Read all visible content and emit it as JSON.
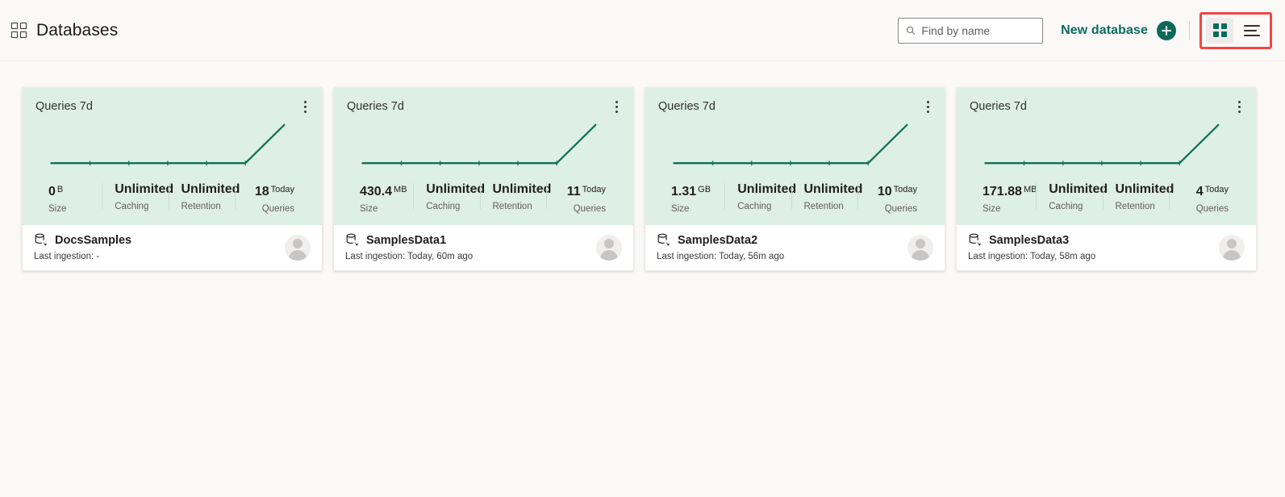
{
  "header": {
    "icon": "grid-icon",
    "title": "Databases",
    "search": {
      "value": "",
      "placeholder": "Find by name",
      "icon": "search-icon"
    },
    "new_database": {
      "label": "New database",
      "icon": "plus-circle-icon"
    },
    "view_toggle": {
      "grid": {
        "icon": "grid-view-icon",
        "active": true
      },
      "list": {
        "icon": "list-view-icon",
        "active": false
      },
      "highlight_color": "#f4463f"
    }
  },
  "colors": {
    "accent": "#0b6a5a",
    "card_top_bg": "#deefe5",
    "spark_line": "#107159",
    "page_bg": "#faf9f8"
  },
  "chart_data": {
    "type": "line",
    "title": "Queries 7d",
    "x": [
      0,
      1,
      2,
      3,
      4,
      5,
      6
    ],
    "values": [
      0,
      0,
      0,
      0,
      0,
      0,
      1
    ],
    "grid": false,
    "legend": "none",
    "xlabel": "",
    "ylabel": ""
  },
  "cards": [
    {
      "chart_title": "Queries 7d",
      "menu_icon": "kebab-menu-icon",
      "stats": [
        {
          "value": "0",
          "unit": "B",
          "label": "Size"
        },
        {
          "value": "Unlimited",
          "unit": "",
          "label": "Caching"
        },
        {
          "value": "Unlimited",
          "unit": "",
          "label": "Retention"
        },
        {
          "value": "18",
          "unit": "Today",
          "label": "Queries"
        }
      ],
      "db_icon": "database-icon",
      "name": "DocsSamples",
      "last_ingestion": "Last ingestion: -",
      "avatar": "user-avatar"
    },
    {
      "chart_title": "Queries 7d",
      "menu_icon": "kebab-menu-icon",
      "stats": [
        {
          "value": "430.4",
          "unit": "MB",
          "label": "Size"
        },
        {
          "value": "Unlimited",
          "unit": "",
          "label": "Caching"
        },
        {
          "value": "Unlimited",
          "unit": "",
          "label": "Retention"
        },
        {
          "value": "11",
          "unit": "Today",
          "label": "Queries"
        }
      ],
      "db_icon": "database-icon",
      "name": "SamplesData1",
      "last_ingestion": "Last ingestion: Today, 60m ago",
      "avatar": "user-avatar"
    },
    {
      "chart_title": "Queries 7d",
      "menu_icon": "kebab-menu-icon",
      "stats": [
        {
          "value": "1.31",
          "unit": "GB",
          "label": "Size"
        },
        {
          "value": "Unlimited",
          "unit": "",
          "label": "Caching"
        },
        {
          "value": "Unlimited",
          "unit": "",
          "label": "Retention"
        },
        {
          "value": "10",
          "unit": "Today",
          "label": "Queries"
        }
      ],
      "db_icon": "database-icon",
      "name": "SamplesData2",
      "last_ingestion": "Last ingestion: Today, 56m ago",
      "avatar": "user-avatar"
    },
    {
      "chart_title": "Queries 7d",
      "menu_icon": "kebab-menu-icon",
      "stats": [
        {
          "value": "171.88",
          "unit": "MB",
          "label": "Size"
        },
        {
          "value": "Unlimited",
          "unit": "",
          "label": "Caching"
        },
        {
          "value": "Unlimited",
          "unit": "",
          "label": "Retention"
        },
        {
          "value": "4",
          "unit": "Today",
          "label": "Queries"
        }
      ],
      "db_icon": "database-icon",
      "name": "SamplesData3",
      "last_ingestion": "Last ingestion: Today, 58m ago",
      "avatar": "user-avatar"
    }
  ]
}
